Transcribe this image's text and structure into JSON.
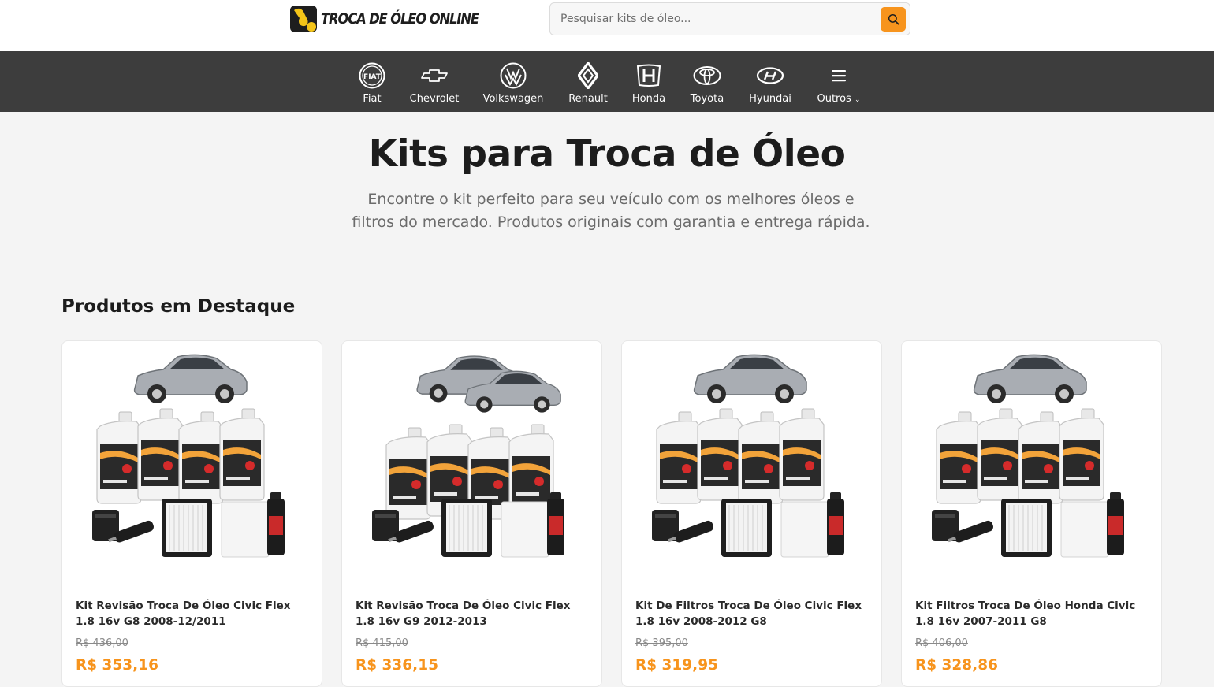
{
  "header": {
    "logo_text": "TROCA DE ÓLEO ONLINE",
    "search_placeholder": "Pesquisar kits de óleo...",
    "accent_color": "#f7941d"
  },
  "brands": [
    {
      "label": "Fiat",
      "icon": "fiat-logo-icon"
    },
    {
      "label": "Chevrolet",
      "icon": "chevrolet-logo-icon"
    },
    {
      "label": "Volkswagen",
      "icon": "volkswagen-logo-icon"
    },
    {
      "label": "Renault",
      "icon": "renault-logo-icon"
    },
    {
      "label": "Honda",
      "icon": "honda-logo-icon"
    },
    {
      "label": "Toyota",
      "icon": "toyota-logo-icon"
    },
    {
      "label": "Hyundai",
      "icon": "hyundai-logo-icon"
    },
    {
      "label": "Outros",
      "icon": "menu-icon"
    }
  ],
  "hero": {
    "title": "Kits para Troca de Óleo",
    "subtitle": "Encontre o kit perfeito para seu veículo com os melhores óleos e filtros do mercado. Produtos originais com garantia e entrega rápida."
  },
  "featured": {
    "title": "Produtos em Destaque",
    "products": [
      {
        "name": "Kit Revisão Troca De Óleo Civic Flex 1.8 16v G8 2008-12/2011",
        "old_price": "R$ 436,00",
        "price": "R$ 353,16"
      },
      {
        "name": "Kit Revisão Troca De Óleo Civic Flex 1.8 16v G9 2012-2013",
        "old_price": "R$ 415,00",
        "price": "R$ 336,15"
      },
      {
        "name": "Kit De Filtros Troca De Óleo Civic Flex 1.8 16v 2008-2012 G8",
        "old_price": "R$ 395,00",
        "price": "R$ 319,95"
      },
      {
        "name": "Kit Filtros Troca De Óleo Honda Civic 1.8 16v 2007-2011 G8",
        "old_price": "R$ 406,00",
        "price": "R$ 328,86"
      }
    ]
  }
}
